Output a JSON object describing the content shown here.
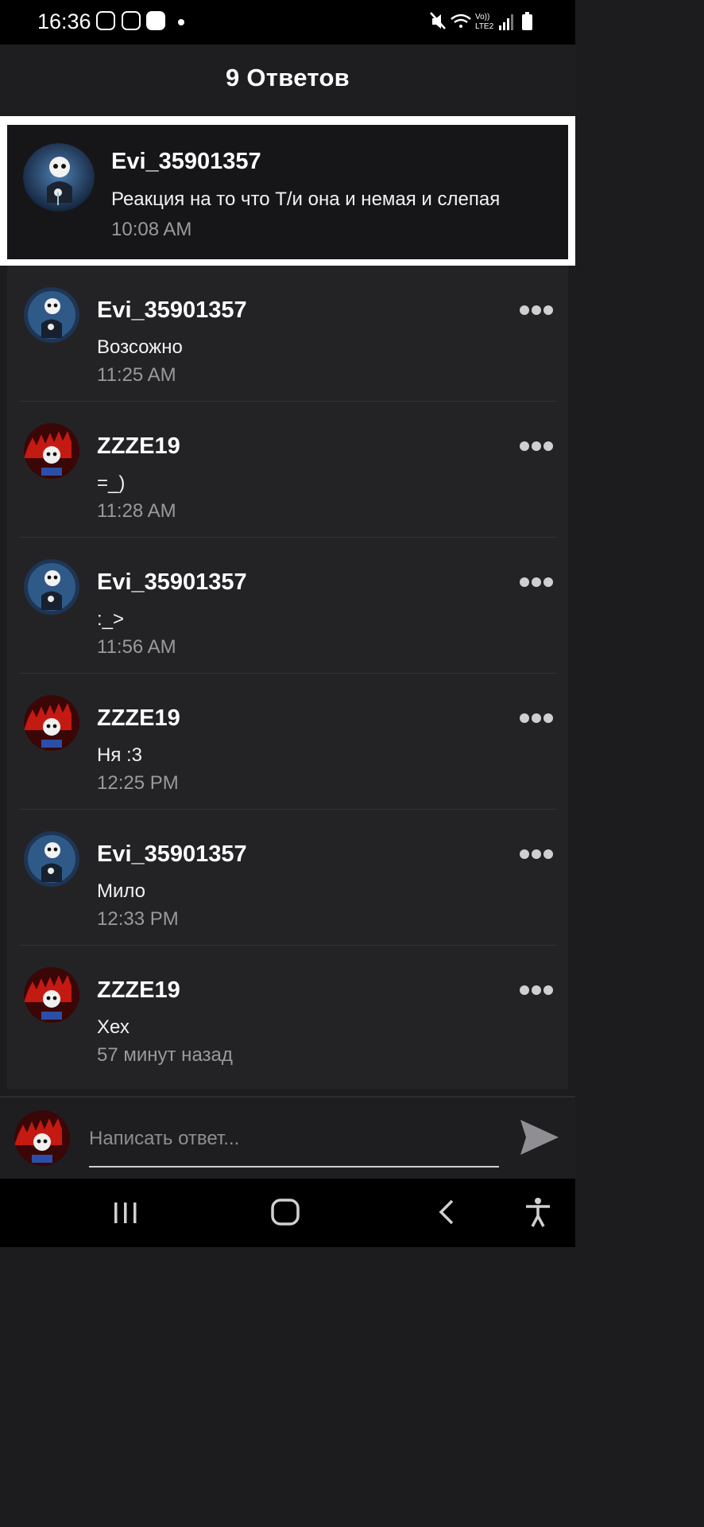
{
  "status_bar": {
    "time": "16:36",
    "left_icons": [
      "viber-icon",
      "viber-icon",
      "tiktok-icon"
    ],
    "right_icons": [
      "mute-icon",
      "wifi-icon",
      "volte-lte2-icon",
      "signal-icon",
      "battery-icon"
    ],
    "network_label_top": "Vo))",
    "network_label_bottom": "LTE2"
  },
  "header": {
    "title": "9 Ответов"
  },
  "original_post": {
    "author": "Evi_35901357",
    "text": "Реакция на то что Т/и она и немая и слепая",
    "time": "10:08 AM",
    "avatar": "skeleton-with-flower-avatar"
  },
  "replies": [
    {
      "author": "Evi_35901357",
      "text": "Возсожно",
      "time": "11:25 AM",
      "avatar": "skeleton-with-flower-avatar"
    },
    {
      "author": "ZZZE19",
      "text": "=_)",
      "time": "11:28 AM",
      "avatar": "red-skeleton-avatar"
    },
    {
      "author": "Evi_35901357",
      "text": ":_>",
      "time": "11:56 AM",
      "avatar": "skeleton-with-flower-avatar"
    },
    {
      "author": "ZZZE19",
      "text": "Ня :3",
      "time": "12:25 PM",
      "avatar": "red-skeleton-avatar"
    },
    {
      "author": "Evi_35901357",
      "text": "Мило",
      "time": "12:33 PM",
      "avatar": "skeleton-with-flower-avatar"
    },
    {
      "author": "ZZZE19",
      "text": "Хех",
      "time": "57 минут назад",
      "avatar": "red-skeleton-avatar"
    }
  ],
  "composer": {
    "placeholder": "Написать ответ...",
    "avatar": "red-skeleton-avatar",
    "send_icon": "send-arrow-icon"
  },
  "nav_bar": {
    "buttons": [
      "recent-apps-icon",
      "home-icon",
      "back-icon",
      "accessibility-icon"
    ]
  },
  "colors": {
    "background": "#1c1c1f",
    "header_bg": "#1e1e21",
    "card_bg": "#232326",
    "highlight_border": "#ffffff",
    "muted_text": "#9a9a9e"
  }
}
